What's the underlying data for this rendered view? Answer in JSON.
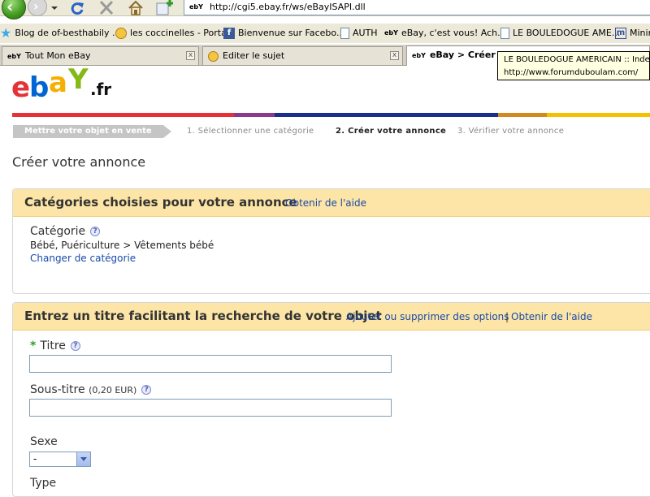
{
  "browser": {
    "url": "http://cgi5.ebay.fr/ws/eBayISAPI.dll",
    "url_favicon": "ebY"
  },
  "bookmarks": [
    {
      "label": "Blog de of-besthabily ...",
      "icon": "star-icon"
    },
    {
      "label": "les coccinelles - Portail",
      "icon": "smiley-icon"
    },
    {
      "label": "Bienvenue sur Facebo...",
      "icon": "facebook-icon",
      "glyph": "f"
    },
    {
      "label": "AUTH",
      "icon": "page-icon"
    },
    {
      "label": "eBay, c'est vous! Ach...",
      "icon": "ebay-icon",
      "glyph": "ebY"
    },
    {
      "label": "LE BOULEDOGUE AME...",
      "icon": "page-icon"
    },
    {
      "label": "Minin",
      "icon": "m-icon",
      "glyph": "m"
    }
  ],
  "tabs": [
    {
      "label": "Tout Mon eBay",
      "glyph": "ebY",
      "active": false
    },
    {
      "label": "Editer le sujet",
      "active": false
    },
    {
      "label": "eBay > Créer v",
      "glyph": "ebY",
      "active": true
    }
  ],
  "tab_close_glyph": "x",
  "tooltip": {
    "line1": "LE BOULEDOGUE AMERICAIN :: Index",
    "line2": "http://www.forumduboulam.com/"
  },
  "logo": {
    "e": "e",
    "b": "b",
    "a": "a",
    "y": "Y",
    "fr": ".fr"
  },
  "colors": {
    "red": "#e53238",
    "blue": "#0064d2",
    "yellow": "#f5af02",
    "green": "#86b817",
    "link": "#1a4aa8",
    "section_header": "#fce5a6"
  },
  "steps": {
    "current": "Mettre votre objet en vente",
    "items": [
      {
        "label": "1. Sélectionner une catégorie",
        "bold": false
      },
      {
        "label": "2. Créer votre annonce",
        "bold": true
      },
      {
        "label": "3. Vérifier votre annonce",
        "bold": false
      }
    ]
  },
  "page_title": "Créer votre annonce",
  "help_glyph": "?",
  "section_category": {
    "title": "Catégories choisies pour votre annonce",
    "help_link": "Obtenir de l'aide",
    "category_label": "Catégorie",
    "category_value": "Bébé, Puériculture > Vêtements bébé",
    "change_link": "Changer de catégorie"
  },
  "section_title": {
    "title": "Entrez un titre facilitant la recherche de votre objet",
    "options_link": "Ajouter ou supprimer des options",
    "separator": "|",
    "help_link": "Obtenir de l'aide",
    "required_marker": "*",
    "title_label": "Titre",
    "title_value": "",
    "subtitle_label": "Sous-titre",
    "subtitle_price": "(0,20 EUR)",
    "subtitle_value": "",
    "sex_label": "Sexe",
    "sex_selected": "-",
    "type_label": "Type"
  }
}
